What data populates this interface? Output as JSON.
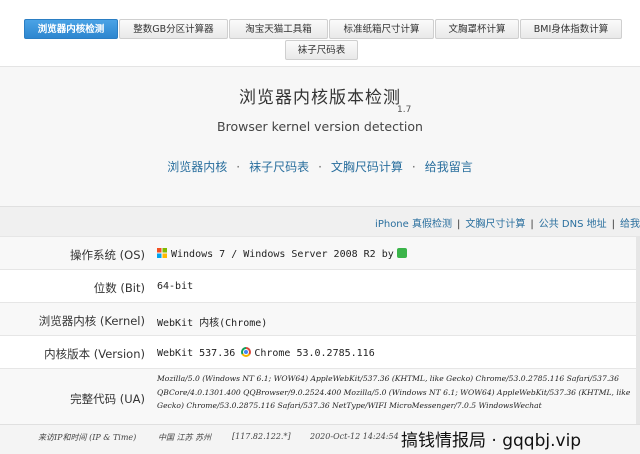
{
  "tabs": [
    {
      "label": "浏览器内核检测",
      "active": true
    },
    {
      "label": "整数GB分区计算器"
    },
    {
      "label": "淘宝天猫工具箱"
    },
    {
      "label": "标准纸箱尺寸计算"
    },
    {
      "label": "文胸罩杯计算"
    },
    {
      "label": "BMI身体指数计算"
    },
    {
      "label": "袜子尺码表"
    }
  ],
  "header": {
    "title": "浏览器内核版本检测",
    "version": "1.7",
    "subtitle": "Browser kernel version detection"
  },
  "nav_links": [
    {
      "label": "浏览器内核"
    },
    {
      "label": "袜子尺码表"
    },
    {
      "label": "文胸尺码计算"
    },
    {
      "label": "给我留言"
    }
  ],
  "nav_separator": "·",
  "toolbar_links": [
    {
      "label": "iPhone 真假检测"
    },
    {
      "label": "文胸尺寸计算"
    },
    {
      "label": "公共 DNS 地址"
    },
    {
      "label": "给我"
    }
  ],
  "toolbar_separator": "|",
  "info": {
    "os_label": "操作系统 (OS)",
    "os_value": "Windows 7 / Windows Server 2008 R2 by",
    "bit_label": "位数 (Bit)",
    "bit_value": "64-bit",
    "kernel_label": "浏览器内核 (Kernel)",
    "kernel_value": "WebKit 内核(Chrome)",
    "version_label": "内核版本 (Version)",
    "version_value_webkit": "WebKit 537.36",
    "version_value_chrome": "Chrome 53.0.2785.116",
    "ua_label": "完整代码 (UA)",
    "ua_value": "Mozilla/5.0 (Windows NT 6.1; WOW64) AppleWebKit/537.36 (KHTML, like Gecko) Chrome/53.0.2785.116 Safari/537.36 QBCore/4.0.1301.400 QQBrowser/9.0.2524.400 Mozilla/5.0 (Windows NT 6.1; WOW64) AppleWebKit/537.36 (KHTML, like Gecko) Chrome/53.0.2875.116 Safari/537.36 NetType/WIFI MicroMessenger/7.0.5 WindowsWechat"
  },
  "visit": {
    "label": "来访IP和时间 (IP & Time)",
    "location": "中国 江苏 苏州",
    "ip": "[117.82.122.*]",
    "time": "2020-Oct-12 14:24:54"
  },
  "watermark": "搞钱情报局 · gqqbj.vip",
  "icons": {
    "os": "windows-icon",
    "by": "wechat-icon",
    "browser": "chrome-icon"
  },
  "colors": {
    "active_tab": "#2d86cf",
    "link": "#2a6f9e",
    "wechat": "#3bb44a"
  }
}
